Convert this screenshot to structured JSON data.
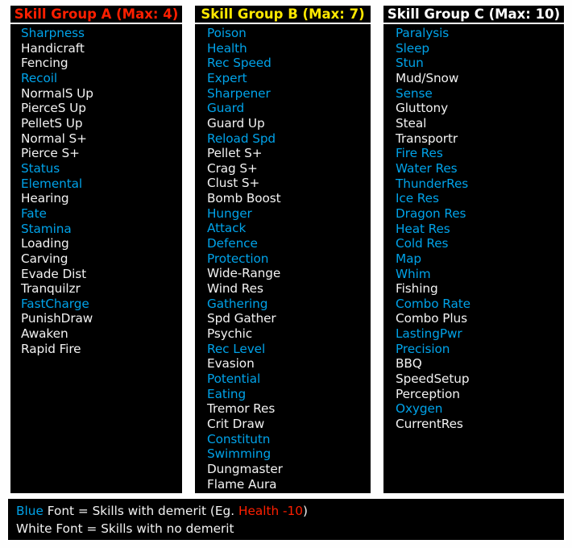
{
  "colors": {
    "demerit_blue": "#00a2e8",
    "no_demerit_white": "#f2f2f2",
    "group_a_header": "#ff1f00",
    "group_b_header": "#ffe800",
    "group_c_header": "#ffffff",
    "example_red": "#ff1f00",
    "panel_background": "#000000",
    "panel_border": "#ffffff"
  },
  "groups": [
    {
      "id": "a",
      "header": "Skill Group A (Max: 4)",
      "max": 4,
      "skills": [
        {
          "label": "Sharpness",
          "demerit": true
        },
        {
          "label": "Handicraft",
          "demerit": false
        },
        {
          "label": "Fencing",
          "demerit": false
        },
        {
          "label": "Recoil",
          "demerit": true
        },
        {
          "label": "NormalS Up",
          "demerit": false
        },
        {
          "label": "PierceS Up",
          "demerit": false
        },
        {
          "label": "PelletS Up",
          "demerit": false
        },
        {
          "label": "Normal S+",
          "demerit": false
        },
        {
          "label": "Pierce S+",
          "demerit": false
        },
        {
          "label": "Status",
          "demerit": true
        },
        {
          "label": "Elemental",
          "demerit": true
        },
        {
          "label": "Hearing",
          "demerit": false
        },
        {
          "label": "Fate",
          "demerit": true
        },
        {
          "label": "Stamina",
          "demerit": true
        },
        {
          "label": "Loading",
          "demerit": false
        },
        {
          "label": "Carving",
          "demerit": false
        },
        {
          "label": "Evade Dist",
          "demerit": false
        },
        {
          "label": "Tranquilzr",
          "demerit": false
        },
        {
          "label": "FastCharge",
          "demerit": true
        },
        {
          "label": "PunishDraw",
          "demerit": false
        },
        {
          "label": "Awaken",
          "demerit": false
        },
        {
          "label": "Rapid Fire",
          "demerit": false
        }
      ]
    },
    {
      "id": "b",
      "header": "Skill Group B (Max: 7)",
      "max": 7,
      "skills": [
        {
          "label": "Poison",
          "demerit": true
        },
        {
          "label": "Health",
          "demerit": true
        },
        {
          "label": "Rec Speed",
          "demerit": true
        },
        {
          "label": "Expert",
          "demerit": true
        },
        {
          "label": "Sharpener",
          "demerit": true
        },
        {
          "label": "Guard",
          "demerit": true
        },
        {
          "label": "Guard Up",
          "demerit": false
        },
        {
          "label": "Reload Spd",
          "demerit": true
        },
        {
          "label": "Pellet S+",
          "demerit": false
        },
        {
          "label": "Crag S+",
          "demerit": false
        },
        {
          "label": "Clust S+",
          "demerit": false
        },
        {
          "label": "Bomb Boost",
          "demerit": false
        },
        {
          "label": "Hunger",
          "demerit": true
        },
        {
          "label": "Attack",
          "demerit": true
        },
        {
          "label": "Defence",
          "demerit": true
        },
        {
          "label": "Protection",
          "demerit": true
        },
        {
          "label": "Wide-Range",
          "demerit": false
        },
        {
          "label": "Wind Res",
          "demerit": false
        },
        {
          "label": "Gathering",
          "demerit": true
        },
        {
          "label": "Spd Gather",
          "demerit": false
        },
        {
          "label": "Psychic",
          "demerit": false
        },
        {
          "label": "Rec Level",
          "demerit": true
        },
        {
          "label": "Evasion",
          "demerit": false
        },
        {
          "label": "Potential",
          "demerit": true
        },
        {
          "label": "Eating",
          "demerit": true
        },
        {
          "label": "Tremor Res",
          "demerit": false
        },
        {
          "label": "Crit Draw",
          "demerit": false
        },
        {
          "label": "Constitutn",
          "demerit": true
        },
        {
          "label": "Swimming",
          "demerit": true
        },
        {
          "label": "Dungmaster",
          "demerit": false
        },
        {
          "label": "Flame Aura",
          "demerit": false
        }
      ]
    },
    {
      "id": "c",
      "header": "Skill Group C (Max: 10)",
      "max": 10,
      "skills": [
        {
          "label": "Paralysis",
          "demerit": true
        },
        {
          "label": "Sleep",
          "demerit": true
        },
        {
          "label": "Stun",
          "demerit": true
        },
        {
          "label": "Mud/Snow",
          "demerit": false
        },
        {
          "label": "Sense",
          "demerit": true
        },
        {
          "label": "Gluttony",
          "demerit": false
        },
        {
          "label": "Steal",
          "demerit": false
        },
        {
          "label": "Transportr",
          "demerit": false
        },
        {
          "label": "Fire Res",
          "demerit": true
        },
        {
          "label": "Water Res",
          "demerit": true
        },
        {
          "label": "ThunderRes",
          "demerit": true
        },
        {
          "label": "Ice Res",
          "demerit": true
        },
        {
          "label": "Dragon Res",
          "demerit": true
        },
        {
          "label": "Heat Res",
          "demerit": true
        },
        {
          "label": "Cold Res",
          "demerit": true
        },
        {
          "label": "Map",
          "demerit": true
        },
        {
          "label": "Whim",
          "demerit": true
        },
        {
          "label": "Fishing",
          "demerit": false
        },
        {
          "label": "Combo Rate",
          "demerit": true
        },
        {
          "label": "Combo Plus",
          "demerit": false
        },
        {
          "label": "LastingPwr",
          "demerit": true
        },
        {
          "label": "Precision",
          "demerit": true
        },
        {
          "label": "BBQ",
          "demerit": false
        },
        {
          "label": "SpeedSetup",
          "demerit": false
        },
        {
          "label": "Perception",
          "demerit": false
        },
        {
          "label": "Oxygen",
          "demerit": true
        },
        {
          "label": "CurrentRes",
          "demerit": false
        }
      ]
    }
  ],
  "legend": {
    "line1": {
      "keyword": "Blue",
      "text": " Font = Skills with demerit (Eg. ",
      "example": "Health -10",
      "suffix": ")"
    },
    "line2": {
      "text": "White Font = Skills with no demerit"
    }
  }
}
